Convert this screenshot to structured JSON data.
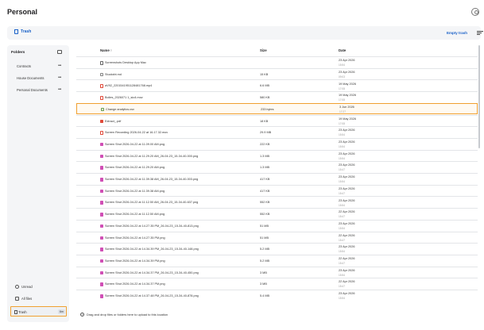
{
  "page": {
    "title": "Personal"
  },
  "toolbar": {
    "trash_label": "Trash",
    "empty_trash_label": "Empty trash"
  },
  "sidebar": {
    "folders_heading": "Folders",
    "folders": [
      {
        "label": "Contracts"
      },
      {
        "label": "House Documents"
      },
      {
        "label": "Personal Documents"
      }
    ],
    "bottom": {
      "unread_label": "Unread",
      "all_files_label": "All files",
      "trash_label": "Trash",
      "trash_badge": "6m"
    }
  },
  "table": {
    "columns": {
      "name": "Name ↑",
      "size": "Size",
      "date": "Date"
    },
    "rows": [
      {
        "type": "folder",
        "name": "Screenshots Desktop App Mac",
        "size": "",
        "date": "23 Apr 2026",
        "time": "15:54"
      },
      {
        "type": "file",
        "name": "Stuckxbt.md",
        "size": "15 KB",
        "date": "23 Apr 2026",
        "time": "09:03"
      },
      {
        "type": "video",
        "name": "aV92_2201541951128481768.mp4",
        "size": "6.6 MB",
        "date": "19 May 2026",
        "time": "17:08"
      },
      {
        "type": "video",
        "name": "Bolies_2026071 1_sio4.mov",
        "size": "580 KB",
        "date": "19 May 2026",
        "time": "17:08"
      },
      {
        "type": "csv",
        "name": "Change analytics.csv",
        "size": "233 bytes",
        "date": "3 Jun 2026",
        "time": "17:27",
        "selected": true
      },
      {
        "type": "pdf",
        "name": "Extract_.pdf",
        "size": "18 KB",
        "date": "19 May 2026",
        "time": "17:08"
      },
      {
        "type": "video",
        "name": "Screen Recording 2026-04-22 at 16.17.32.mov",
        "size": "29.9 MB",
        "date": "23 Apr 2026",
        "time": "15:54"
      },
      {
        "type": "image",
        "name": "Screen Shot 2026-04-22 at 11.09.00 AM.png",
        "size": "222 KB",
        "date": "23 Apr 2026",
        "time": "15:54"
      },
      {
        "type": "image",
        "name": "Screen Shot 2026-04-22 at 11.29.20 AM_26-04-23_15-34-40-000.png",
        "size": "1.3 MB",
        "date": "23 Apr 2026",
        "time": "15:54"
      },
      {
        "type": "image",
        "name": "Screen Shot 2026-04-22 at 11.29.20 AM.png",
        "size": "1.3 MB",
        "date": "23 Apr 2026",
        "time": "15:47"
      },
      {
        "type": "image",
        "name": "Screen Shot 2026-04-22 at 11.39.38 AM_26-04-23_15-34-40-003.png",
        "size": "417 KB",
        "date": "23 Apr 2026",
        "time": "15:54"
      },
      {
        "type": "image",
        "name": "Screen Shot 2026-04-22 at 11.39.38 AM.png",
        "size": "417 KB",
        "date": "23 Apr 2026",
        "time": "15:47"
      },
      {
        "type": "image",
        "name": "Screen Shot 2026-04-22 at 11.12.50 AM_26-04-23_15-34-40-637.png",
        "size": "552 KB",
        "date": "23 Apr 2026",
        "time": "15:54"
      },
      {
        "type": "image",
        "name": "Screen Shot 2026-04-22 at 11.12.50 AM.png",
        "size": "552 KB",
        "date": "22 Apr 2026",
        "time": "15:47"
      },
      {
        "type": "image",
        "name": "Screen Shot 2026-04-22 at 14.27.35 PM_26-04-23_15-34-40-813.png",
        "size": "51 MB",
        "date": "23 Apr 2026",
        "time": "15:54"
      },
      {
        "type": "image",
        "name": "Screen Shot 2026-04-22 at 14.27.35 PM.png",
        "size": "51 MB",
        "date": "22 Apr 2026",
        "time": "15:47"
      },
      {
        "type": "image",
        "name": "Screen Shot 2026-04-22 at 14.34.39 PM_26-04-23_15-34-40-148.png",
        "size": "5.2 MB",
        "date": "23 Apr 2026",
        "time": "15:54"
      },
      {
        "type": "image",
        "name": "Screen Shot 2026-04-22 at 14.34.39 PM.png",
        "size": "5.2 MB",
        "date": "22 Apr 2026",
        "time": "15:47"
      },
      {
        "type": "image",
        "name": "Screen Shot 2026-04-22 at 14.34.37 PM_26-04-23_15-34-40-450.png",
        "size": "3 MB",
        "date": "23 Apr 2026",
        "time": "15:54"
      },
      {
        "type": "image",
        "name": "Screen Shot 2026-04-22 at 14.34.37 PM.png",
        "size": "3 MB",
        "date": "22 Apr 2026",
        "time": "15:47"
      },
      {
        "type": "image",
        "name": "Screen Shot 2026-04-22 at 14.37.48 PM_26-04-23_15-34-40-878.png",
        "size": "5.4 MB",
        "date": "23 Apr 2026",
        "time": "15:54"
      }
    ]
  },
  "dropzone": {
    "text": "Drag and drop files or folders here to upload to this location"
  }
}
